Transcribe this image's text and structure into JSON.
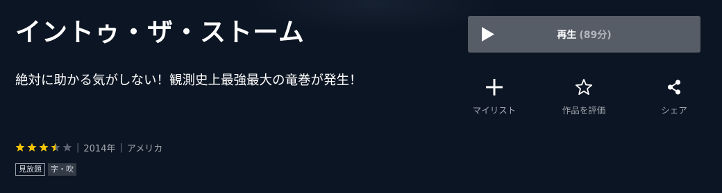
{
  "title": "イントゥ・ザ・ストーム",
  "catchcopy": "絶対に助かる気がしない！観測史上最強最大の竜巻が発生！",
  "rating": {
    "value": 3.5,
    "max": 5,
    "star_color": "#f5c400",
    "empty_color": "#5b6270"
  },
  "meta": {
    "year": "2014年",
    "country": "アメリカ",
    "separator": "|"
  },
  "tags": [
    "見放題",
    "字・吹"
  ],
  "play": {
    "label": "再生",
    "duration": "(89分)"
  },
  "actions": {
    "mylist": {
      "label": "マイリスト",
      "icon": "plus-icon"
    },
    "review": {
      "label": "作品を評価",
      "icon": "star-outline-icon"
    },
    "share": {
      "label": "シェア",
      "icon": "share-icon"
    }
  }
}
